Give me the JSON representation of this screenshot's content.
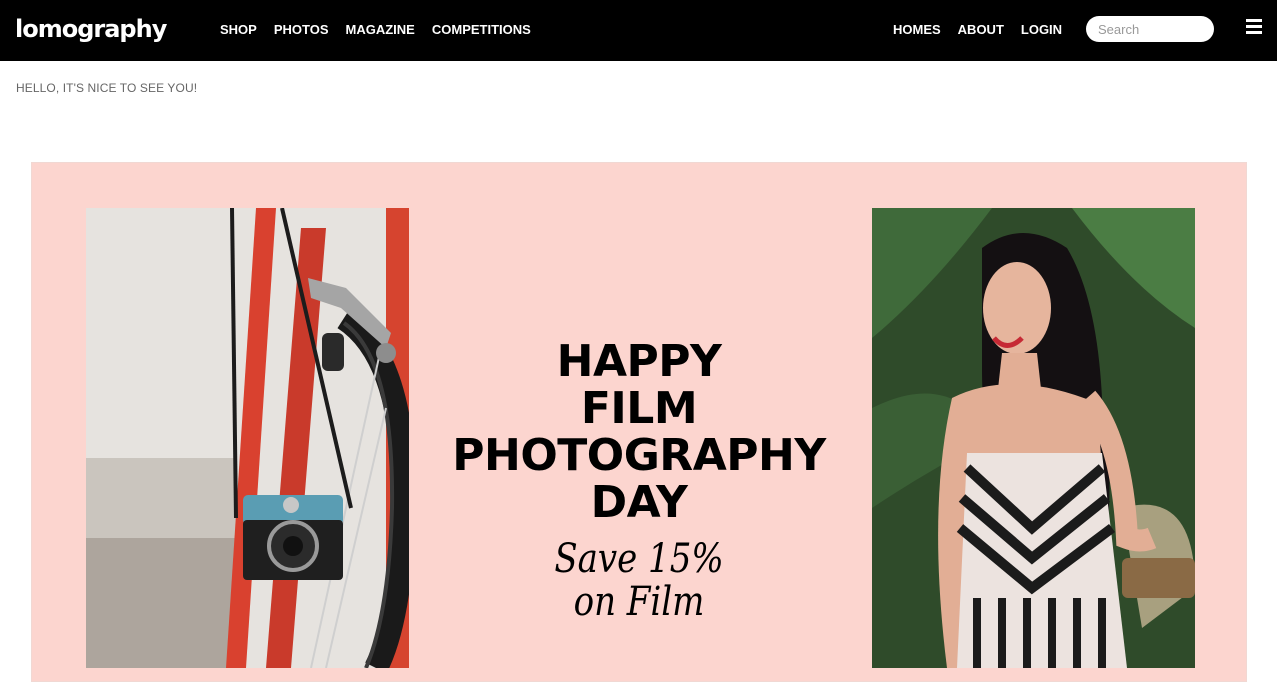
{
  "brand": {
    "logo_text": "lomography"
  },
  "nav": {
    "left": [
      "SHOP",
      "PHOTOS",
      "MAGAZINE",
      "COMPETITIONS"
    ],
    "right": [
      "HOMES",
      "ABOUT",
      "LOGIN"
    ]
  },
  "search": {
    "placeholder": "Search"
  },
  "menu": {
    "icon": "hamburger-icon"
  },
  "greeting": "HELLO, IT'S NICE TO SEE YOU!",
  "hero": {
    "headline_lines": [
      "HAPPY",
      "FILM",
      "PHOTOGRAPHY",
      "DAY"
    ],
    "offer_lines": [
      "Save 15%",
      "on Film"
    ],
    "background_color": "#fcd5cf"
  }
}
